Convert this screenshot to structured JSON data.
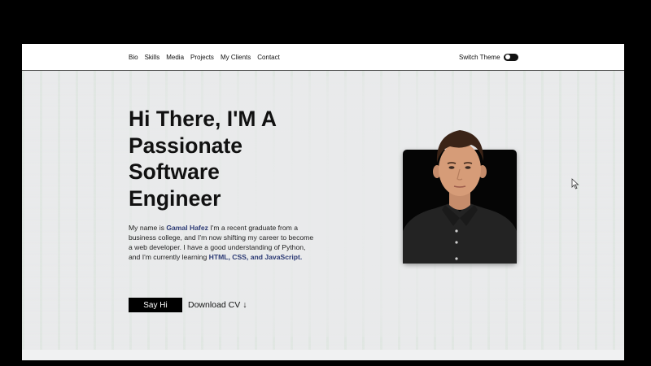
{
  "nav": {
    "links": [
      "Bio",
      "Skills",
      "Media",
      "Projects",
      "My Clients",
      "Contact"
    ],
    "theme_label": "Switch Theme",
    "theme_toggle_on": true
  },
  "hero": {
    "title_lines": [
      "Hi There, I'M A",
      "Passionate",
      "Software",
      "Engineer"
    ],
    "intro": {
      "p1": "My name is ",
      "name": "Gamal Hafez",
      "p2": " I'm a recent graduate from a business college, and I'm now shifting my career to become a web developer. I have a good understanding of Python, and I'm currently learning ",
      "skills": "HTML, CSS, and JavaScript."
    },
    "say_hi_label": "Say Hi",
    "download_label": "Download CV",
    "download_icon": "down-arrow-icon"
  },
  "colors": {
    "highlight": "#2c3a74",
    "page_bg": "#e9eaeb",
    "button_bg": "#000000"
  }
}
